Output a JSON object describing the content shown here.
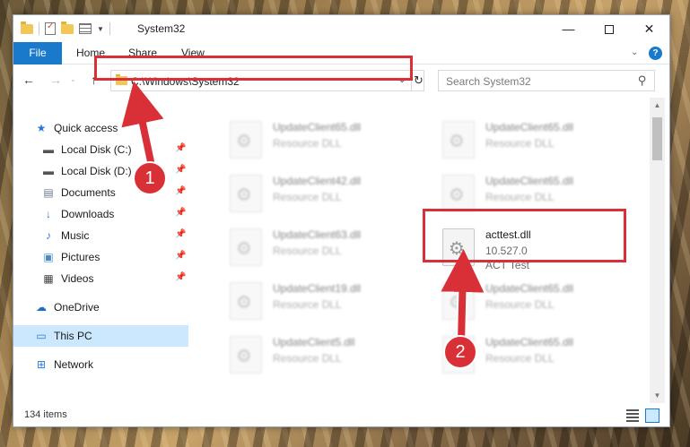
{
  "window": {
    "title": "System32",
    "minimize_glyph": "—",
    "close_glyph": "✕"
  },
  "ribbon": {
    "tabs": [
      "File",
      "Home",
      "Share",
      "View"
    ],
    "expand_glyph": "⌄",
    "help_glyph": "?"
  },
  "navigation": {
    "back_glyph": "←",
    "forward_glyph": "→",
    "recent_glyph": "⌄",
    "up_glyph": "↑",
    "address": "C:\\Windows\\System32",
    "address_chevron": "⌄",
    "refresh_glyph": "↻",
    "search_placeholder": "Search System32",
    "search_glyph": "⚲"
  },
  "sidebar": {
    "pin_glyph": "📌",
    "items": [
      {
        "label": "Quick access",
        "icon": "star-icon",
        "glyph": "★",
        "color": "#2a7ad4"
      },
      {
        "label": "Local Disk (C:)",
        "icon": "drive-icon",
        "glyph": "▬",
        "color": "#555555",
        "pinned": true
      },
      {
        "label": "Local Disk (D:)",
        "icon": "drive-icon",
        "glyph": "▬",
        "color": "#555555",
        "pinned": true
      },
      {
        "label": "Documents",
        "icon": "document-icon",
        "glyph": "▤",
        "color": "#6b7a8c",
        "pinned": true
      },
      {
        "label": "Downloads",
        "icon": "download-icon",
        "glyph": "↓",
        "color": "#2a7ad4",
        "pinned": true
      },
      {
        "label": "Music",
        "icon": "music-icon",
        "glyph": "♪",
        "color": "#2a7ad4",
        "pinned": true
      },
      {
        "label": "Pictures",
        "icon": "picture-icon",
        "glyph": "▣",
        "color": "#4a8cc4",
        "pinned": true
      },
      {
        "label": "Videos",
        "icon": "video-icon",
        "glyph": "▦",
        "color": "#444444",
        "pinned": true
      },
      {
        "label": "OneDrive",
        "icon": "cloud-icon",
        "glyph": "☁",
        "color": "#1e6fc4"
      },
      {
        "label": "This PC",
        "icon": "computer-icon",
        "glyph": "▭",
        "color": "#2a7ad4",
        "selected": true
      },
      {
        "label": "Network",
        "icon": "network-icon",
        "glyph": "⊞",
        "color": "#2a7ad4"
      }
    ]
  },
  "files": [
    {
      "name": "UpdateClient65.dll",
      "type": "Resource DLL",
      "blurred": true
    },
    {
      "name": "UpdateClient65.dll",
      "type": "Resource DLL",
      "blurred": true
    },
    {
      "name": "UpdateClient42.dll",
      "type": "Resource DLL",
      "blurred": true
    },
    {
      "name": "UpdateClient65.dll",
      "type": "Resource DLL",
      "blurred": true
    },
    {
      "name": "UpdateClient63.dll",
      "type": "Resource DLL",
      "blurred": true
    },
    {
      "name": "acttest.dll",
      "version": "10.527.0",
      "type": "ACT Test",
      "blurred": false
    },
    {
      "name": "UpdateClient19.dll",
      "type": "Resource DLL",
      "blurred": true
    },
    {
      "name": "UpdateClient65.dll",
      "type": "Resource DLL",
      "blurred": true
    },
    {
      "name": "UpdateClient5.dll",
      "type": "Resource DLL",
      "blurred": true
    },
    {
      "name": "UpdateClient65.dll",
      "type": "Resource DLL",
      "blurred": true
    }
  ],
  "status": {
    "item_count": "134 items"
  },
  "markers": [
    "1",
    "2"
  ],
  "colors": {
    "accent": "#1979ca",
    "callout": "#d93038",
    "selection": "#cce8ff"
  }
}
